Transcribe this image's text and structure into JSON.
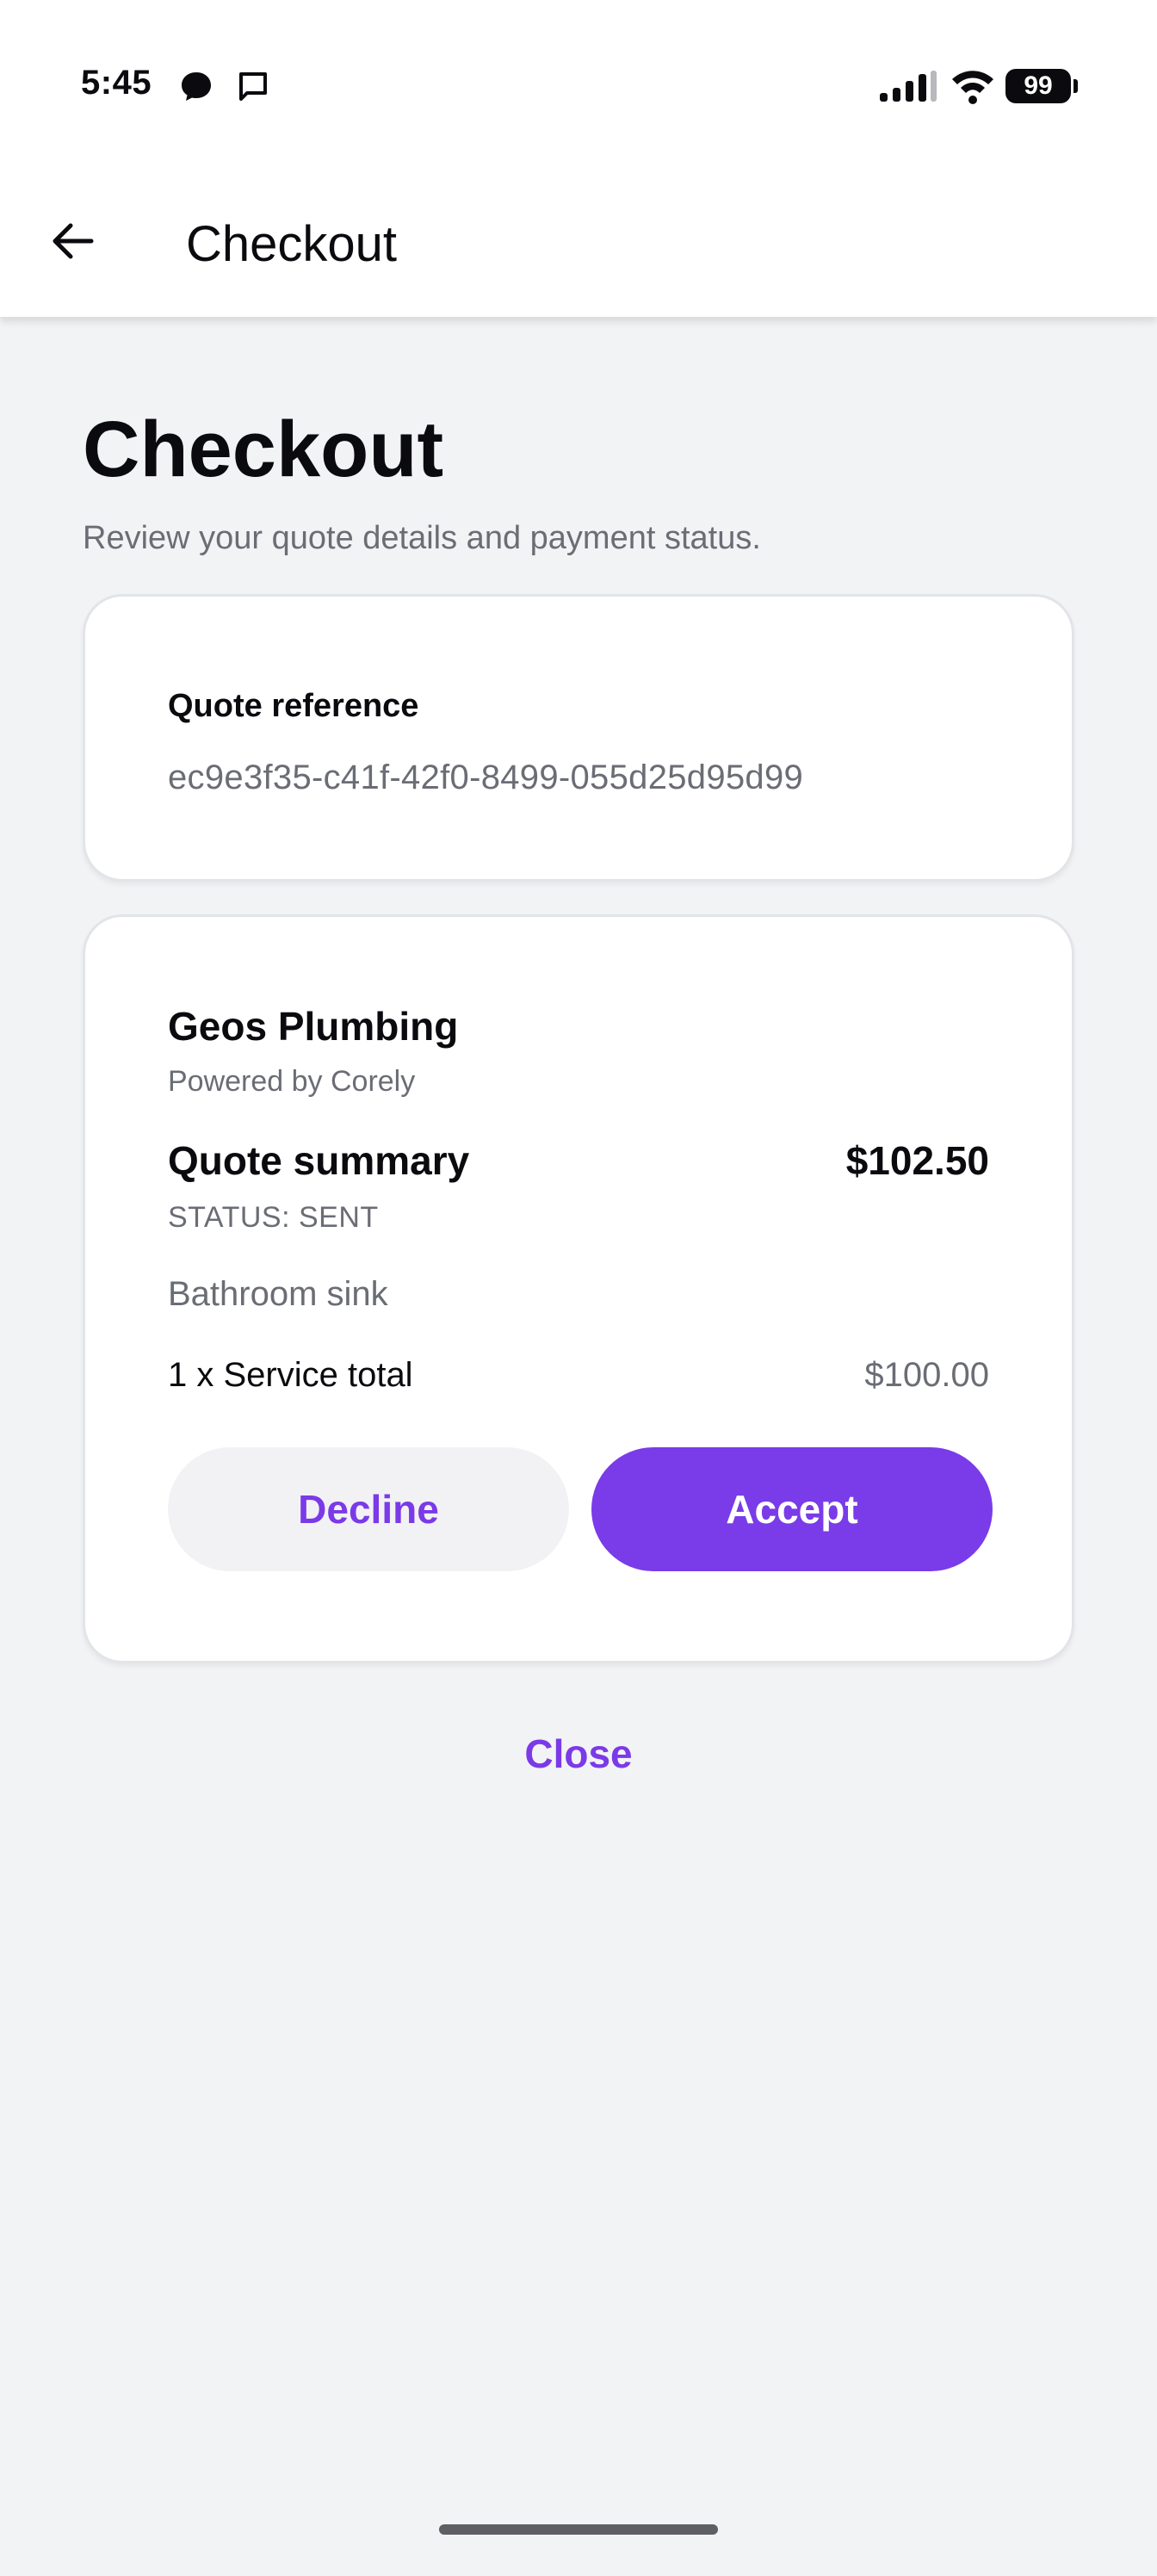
{
  "status_bar": {
    "time": "5:45",
    "battery": "99",
    "icons": [
      "messenger-icon",
      "message-icon",
      "signal-icon",
      "wifi-icon",
      "battery-icon"
    ]
  },
  "app_bar": {
    "title": "Checkout",
    "back_icon": "arrow-left-icon"
  },
  "page": {
    "title": "Checkout",
    "subtitle": "Review your quote details and payment status."
  },
  "reference_card": {
    "label": "Quote reference",
    "value": "ec9e3f35-c41f-42f0-8499-055d25d95d99"
  },
  "quote_card": {
    "business_name": "Geos Plumbing",
    "powered_by": "Powered by Corely",
    "summary_label": "Quote summary",
    "total": "$102.50",
    "status": "STATUS: SENT",
    "item_description": "Bathroom sink",
    "line_label": "1 x Service total",
    "line_amount": "$100.00",
    "decline_label": "Decline",
    "accept_label": "Accept"
  },
  "close_label": "Close",
  "colors": {
    "accent": "#7b3ae8",
    "background": "#f2f3f5",
    "muted_text": "#6b6d75"
  }
}
